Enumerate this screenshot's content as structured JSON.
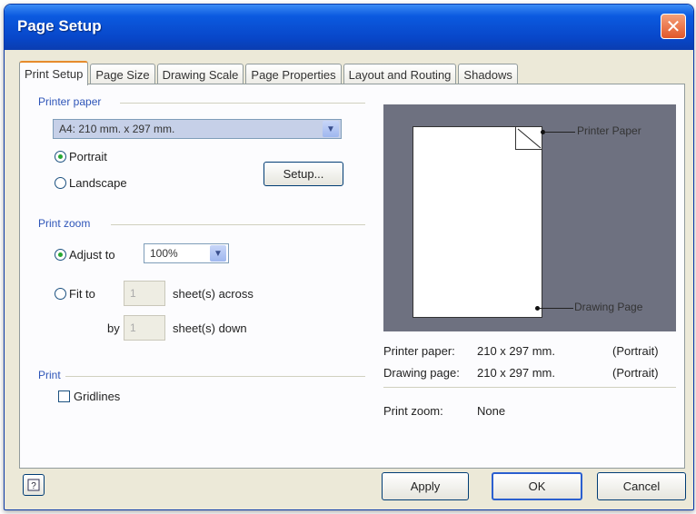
{
  "window": {
    "title": "Page Setup"
  },
  "tabs": [
    {
      "label": "Print Setup",
      "active": true
    },
    {
      "label": "Page Size"
    },
    {
      "label": "Drawing Scale"
    },
    {
      "label": "Page Properties"
    },
    {
      "label": "Layout and Routing"
    },
    {
      "label": "Shadows"
    }
  ],
  "printer_paper": {
    "group_label": "Printer paper",
    "selected": "A4:  210 mm. x 297 mm.",
    "portrait_label": "Portrait",
    "landscape_label": "Landscape",
    "orientation": "Portrait",
    "setup_label": "Setup..."
  },
  "print_zoom": {
    "group_label": "Print zoom",
    "adjust_label": "Adjust to",
    "adjust_value": "100%",
    "fit_label": "Fit to",
    "fit_across": "1",
    "across_label": "sheet(s) across",
    "by_label": "by",
    "fit_down": "1",
    "down_label": "sheet(s) down",
    "mode": "Adjust to"
  },
  "print": {
    "group_label": "Print",
    "gridlines_label": "Gridlines",
    "gridlines_checked": false
  },
  "preview": {
    "printer_paper_callout": "Printer Paper",
    "drawing_page_callout": "Drawing Page"
  },
  "info": {
    "printer_paper_label": "Printer paper:",
    "printer_paper_size": "210 x 297 mm.",
    "printer_paper_orientation": "(Portrait)",
    "drawing_page_label": "Drawing page:",
    "drawing_page_size": "210 x 297 mm.",
    "drawing_page_orientation": "(Portrait)",
    "print_zoom_label": "Print zoom:",
    "print_zoom_value": "None"
  },
  "footer": {
    "help_icon": "help-icon",
    "apply_label": "Apply",
    "ok_label": "OK",
    "cancel_label": "Cancel"
  },
  "colors": {
    "title_bar": "#0846c8",
    "group_label": "#2e55b8",
    "preview_bg": "#6e7180",
    "close_button": "#e2572a"
  }
}
